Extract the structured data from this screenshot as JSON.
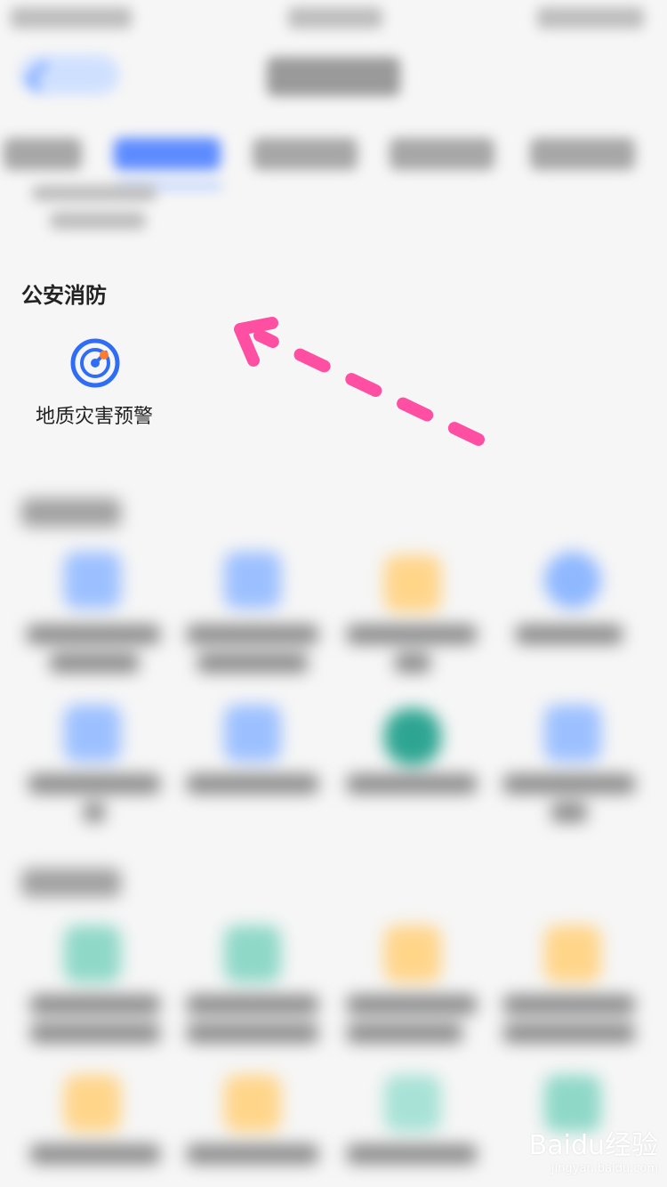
{
  "section": {
    "title": "公安消防",
    "app": {
      "label": "地质灾害预警",
      "icon": "radar-target-icon"
    }
  },
  "watermark": {
    "main": "Baidu经验",
    "sub": "jingyan.baidu.com"
  },
  "colors": {
    "accent_blue": "#2f6df6",
    "icon_orange": "#ff7b2e",
    "annotation_pink": "#ff4fa3"
  }
}
